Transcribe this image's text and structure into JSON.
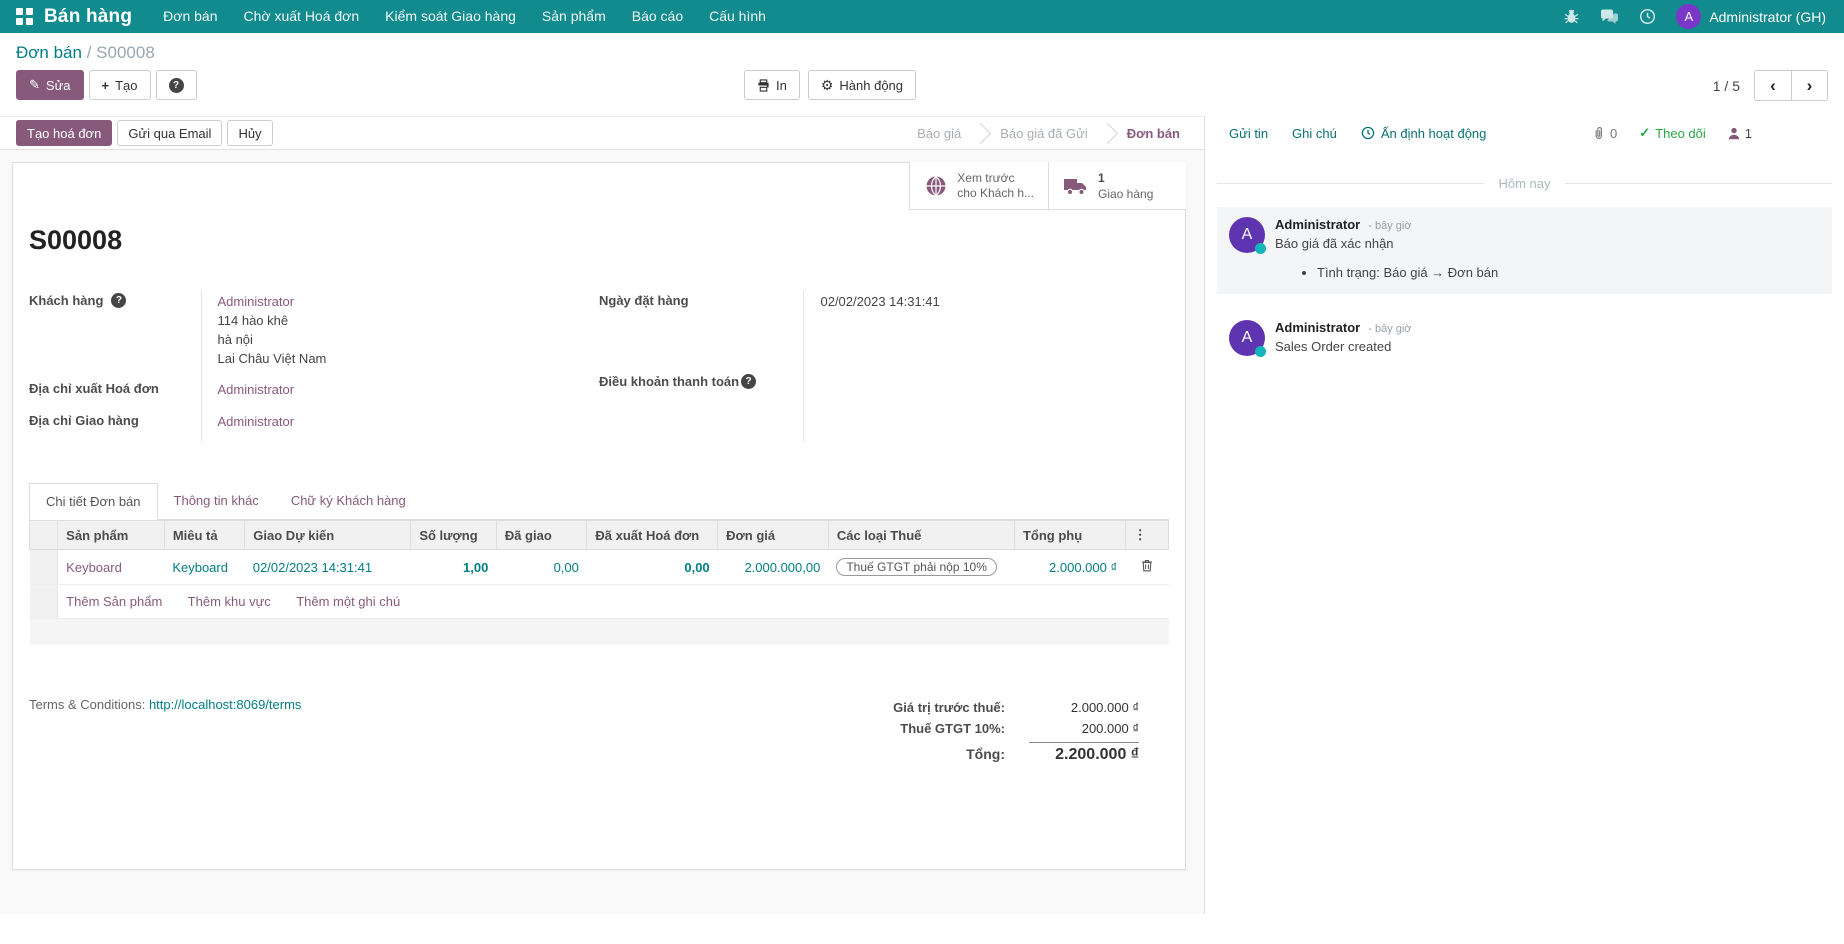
{
  "colors": {
    "navbar": "#118b8e",
    "accent": "#875A7B",
    "link": "#017e84",
    "success": "#28a745"
  },
  "icons": {
    "help": "?",
    "gear": "⚙",
    "pencil": "✎",
    "plus": "+",
    "check": "✓",
    "kebab": "⋮",
    "chev_left": "‹",
    "chev_right": "›"
  },
  "nav": {
    "brand": "Bán hàng",
    "items": [
      "Đơn bán",
      "Chờ xuất Hoá đơn",
      "Kiểm soát Giao hàng",
      "Sản phẩm",
      "Báo cáo",
      "Cấu hình"
    ],
    "avatar_initial": "A",
    "user": "Administrator (GH)"
  },
  "breadcrumb": {
    "parent": "Đơn bán",
    "separator": "/",
    "current": "S00008"
  },
  "control_panel": {
    "edit": "Sửa",
    "create": "Tạo",
    "print": "In",
    "action": "Hành động",
    "pager": "1 / 5"
  },
  "statusbar": {
    "buttons": [
      "Tạo hoá đơn",
      "Gửi qua Email",
      "Hủy"
    ],
    "stages": [
      "Báo giá",
      "Báo giá đã Gửi",
      "Đơn bán"
    ],
    "active_stage": "Đơn bán"
  },
  "smart_buttons": {
    "preview_line1": "Xem trước",
    "preview_line2": "cho Khách h...",
    "delivery_count": "1",
    "delivery_label": "Giao hàng"
  },
  "form": {
    "title": "S00008",
    "customer_label": "Khách hàng",
    "customer": "Administrator",
    "address": [
      "114 hào khê",
      "hà nội",
      "Lai Châu Việt Nam"
    ],
    "invoice_addr_label": "Địa chỉ xuất Hoá đơn",
    "invoice_addr": "Administrator",
    "delivery_addr_label": "Địa chỉ Giao hàng",
    "delivery_addr": "Administrator",
    "order_date_label": "Ngày đặt hàng",
    "order_date": "02/02/2023 14:31:41",
    "payment_terms_label": "Điều khoản thanh toán"
  },
  "tabs": [
    "Chi tiết Đơn bán",
    "Thông tin khác",
    "Chữ ký Khách hàng"
  ],
  "table": {
    "headers": [
      "Sản phẩm",
      "Miêu tả",
      "Giao Dự kiến",
      "Số lượng",
      "Đã giao",
      "Đã xuất Hoá đơn",
      "Đơn giá",
      "Các loại Thuế",
      "Tổng phụ"
    ],
    "row": {
      "product": "Keyboard",
      "description": "Keyboard",
      "expected_date": "02/02/2023 14:31:41",
      "quantity": "1,00",
      "delivered": "0,00",
      "invoiced": "0,00",
      "unit_price": "2.000.000,00",
      "tax": "Thuế GTGT phải nộp 10%",
      "subtotal": "2.000.000 ₫"
    },
    "add_links": [
      "Thêm Sản phẩm",
      "Thêm khu vực",
      "Thêm một ghi chú"
    ]
  },
  "footer": {
    "terms_label": "Terms & Conditions:",
    "terms_link": "http://localhost:8069/terms",
    "totals": [
      {
        "label": "Giá trị trước thuế:",
        "value": "2.000.000 ₫"
      },
      {
        "label": "Thuế GTGT 10%:",
        "value": "200.000 ₫"
      },
      {
        "label": "Tổng:",
        "value": "2.200.000 ₫"
      }
    ]
  },
  "chatter": {
    "send": "Gửi tin",
    "log": "Ghi chú",
    "activity": "Ấn định hoạt động",
    "attachments": "0",
    "follow": "Theo dõi",
    "followers": "1",
    "divider": "Hôm nay",
    "messages": [
      {
        "author": "Administrator",
        "time": "- bây giờ",
        "body": "Báo giá đã xác nhận",
        "tracking": "Tình trạng: Báo giá → Đơn bán"
      },
      {
        "author": "Administrator",
        "time": "- bây giờ",
        "body": "Sales Order created"
      }
    ]
  }
}
